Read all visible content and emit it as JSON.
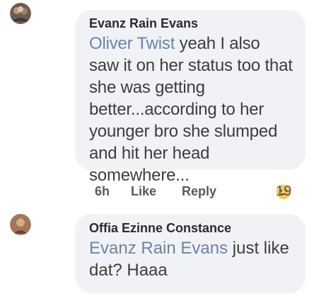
{
  "comments": [
    {
      "author": "Evanz Rain Evans",
      "mention": "Oliver Twist",
      "text": " yeah I also saw it on her status too that she was getting better...according to her younger bro she slumped and hit her head somewhere...",
      "time": "6h",
      "like_label": "Like",
      "reply_label": "Reply",
      "reaction_count": "19",
      "reaction_icon": "sad-reaction-icon"
    },
    {
      "author": "Offia Ezinne Constance",
      "mention": "Evanz Rain Evans",
      "text": " just like dat? Haaa"
    }
  ],
  "colors": {
    "bubble": "#f0f2f5",
    "mention": "#6e82a8",
    "author": "#2b2b2b",
    "text": "#3d3d3d"
  }
}
